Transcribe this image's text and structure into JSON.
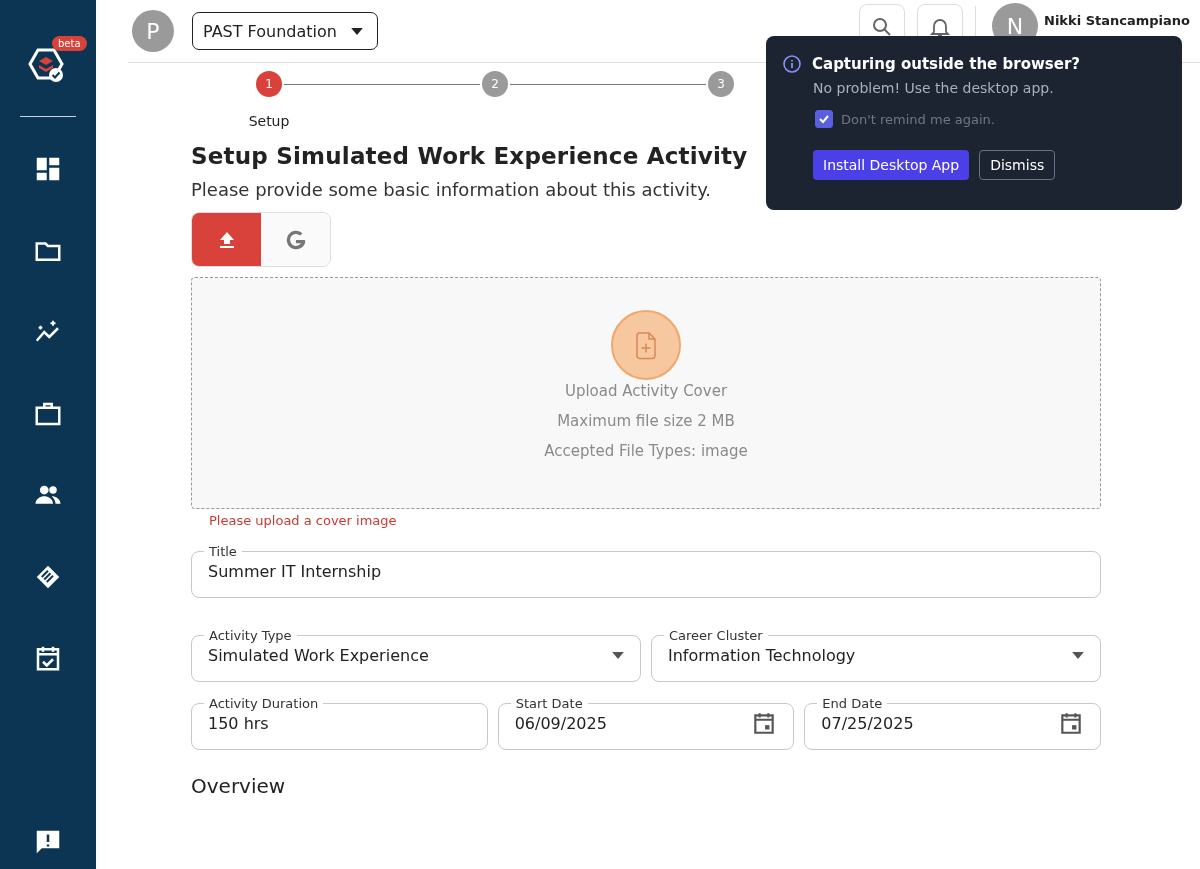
{
  "sidebar": {
    "logo_badge": "beta",
    "items": [
      {
        "kind": "dashboard"
      },
      {
        "kind": "folder"
      },
      {
        "kind": "insights"
      },
      {
        "kind": "briefcase"
      },
      {
        "kind": "people"
      },
      {
        "kind": "handshake"
      },
      {
        "kind": "calendar"
      }
    ]
  },
  "header": {
    "org_initial": "P",
    "org_name": "PAST Foundation",
    "user_initial": "N",
    "user_name": "Nikki Stancampiano"
  },
  "stepper": [
    {
      "number": "1",
      "label": "Setup",
      "selected": true
    },
    {
      "number": "2",
      "selected": false
    },
    {
      "number": "3",
      "selected": false
    }
  ],
  "page": {
    "title": "Setup Simulated Work Experience Activity",
    "subtitle": "Please provide some basic information about this activity."
  },
  "source_toggle": [
    {
      "kind": "upload",
      "selected": true
    },
    {
      "kind": "google",
      "selected": false
    }
  ],
  "dropzone": {
    "lines": [
      "Upload Activity Cover",
      "Maximum file size 2 MB",
      "Accepted File Types: image"
    ],
    "error": "Please upload a cover image"
  },
  "fields": [
    [
      {
        "label": "Title",
        "value": "Summer IT Internship",
        "kind": "text"
      }
    ],
    [
      {
        "label": "Activity Type",
        "value": "Simulated Work Experience",
        "kind": "select"
      },
      {
        "label": "Career Cluster",
        "value": "Information Technology",
        "kind": "select"
      }
    ],
    [
      {
        "label": "Activity Duration",
        "value": "150 hrs",
        "kind": "text"
      },
      {
        "label": "Start Date",
        "value": "06/09/2025",
        "kind": "date"
      },
      {
        "label": "End Date",
        "value": "07/25/2025",
        "kind": "date"
      }
    ]
  ],
  "section_heading": "Overview",
  "popup": {
    "title": "Capturing outside the browser?",
    "message": "No problem! Use the desktop app.",
    "checkbox": {
      "label": "Don't remind me again.",
      "checked": true
    },
    "primary_button": "Install Desktop App",
    "secondary_button": "Dismiss"
  }
}
